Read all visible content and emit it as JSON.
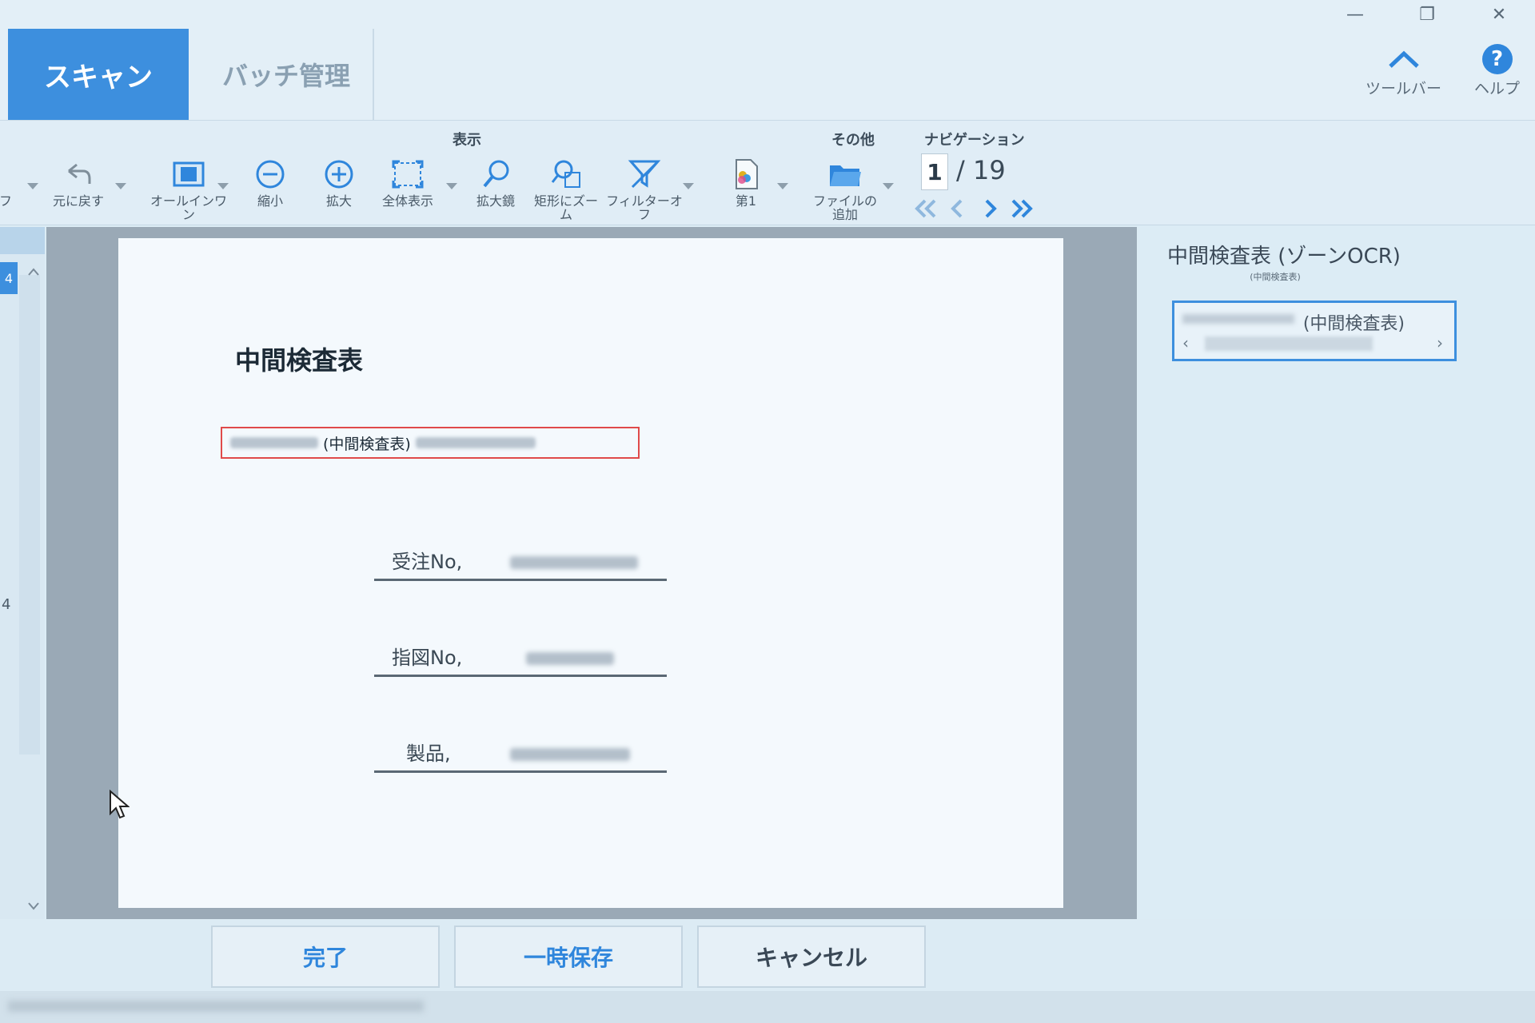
{
  "tabs": {
    "scan": "スキャン",
    "batch": "バッチ管理"
  },
  "window_controls": {
    "minimize": "—",
    "restore": "❐",
    "close": "✕"
  },
  "top_buttons": {
    "toolbar": "ツールバー",
    "help": "ヘルプ",
    "help_glyph": "?"
  },
  "ribbon": {
    "groups": {
      "display": "表示",
      "other": "その他",
      "navigation": "ナビゲーション"
    },
    "partial_left": "フ",
    "undo": "元に戻す",
    "allinone": "オールインワン",
    "zoom_out": "縮小",
    "zoom_in": "拡大",
    "fit": "全体表示",
    "magnifier": "拡大鏡",
    "rect_zoom": "矩形にズーム",
    "filter_off": "フィルターオフ",
    "first": "第1",
    "add_file": "ファイルの追加"
  },
  "navigation": {
    "page": "1",
    "total": "/ 19"
  },
  "thumbs": {
    "mark": "4",
    "num": "4"
  },
  "document": {
    "title": "中間検査表",
    "ocr_text": "(中間検査表)",
    "fields": [
      {
        "label": "受注No,"
      },
      {
        "label": "指図No,"
      },
      {
        "label": "製品,"
      }
    ]
  },
  "right_panel": {
    "title": "中間検査表 (ゾーンOCR)",
    "subtitle": "(中間検査表)",
    "field_value": "(中間検査表)"
  },
  "buttons": {
    "done": "完了",
    "temp_save": "一時保存",
    "cancel": "キャンセル"
  },
  "colors": {
    "accent": "#3d8fde",
    "ocr_border": "#e04a4a"
  }
}
